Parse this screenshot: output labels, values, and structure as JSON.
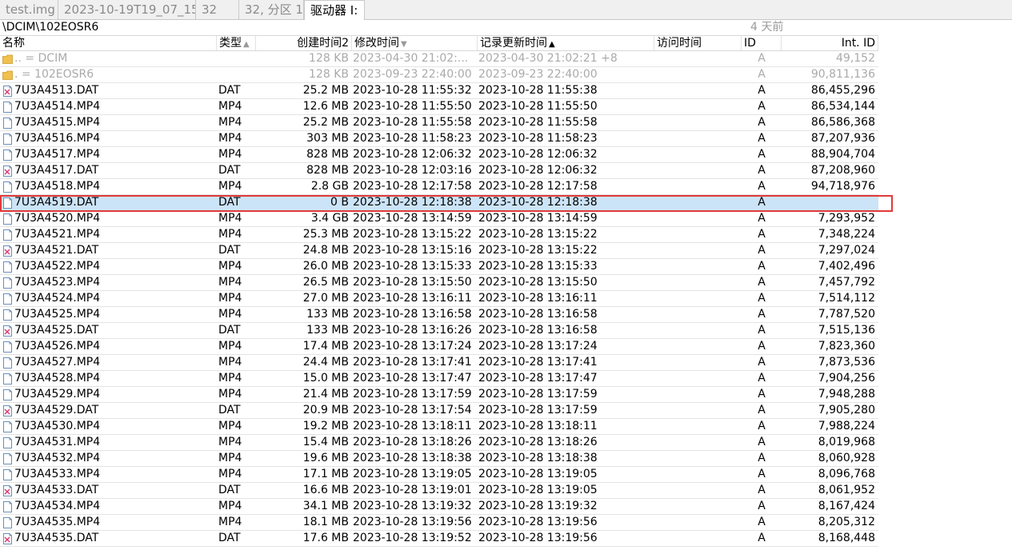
{
  "tabs": [
    "test.img",
    "2023-10-19T19_07_15",
    "32",
    "32, 分区 1",
    "驱动器 I:"
  ],
  "path": "\\DCIM\\102EOSR6",
  "time_ago": "4 天前",
  "columns": {
    "name": "名称",
    "type": "类型",
    "created": "创建时间2",
    "modified": "修改时间",
    "record_updated": "记录更新时间",
    "accessed": "访问时间",
    "id": "ID",
    "int_id": "Int. ID"
  },
  "parent_rows": [
    {
      "name": "..  =   DCIM",
      "size": "128 KB",
      "modified": "2023-04-30  21:02:...",
      "record": "2023-04-30  21:02:21  +8",
      "id": "A",
      "int_id": "49,152"
    },
    {
      "name": ".   =   102EOSR6",
      "size": "128 KB",
      "modified": "2023-09-23  22:40:00",
      "record": "2023-09-23  22:40:00",
      "id": "A",
      "int_id": "90,811,136"
    }
  ],
  "files": [
    {
      "name": "7U3A4513.DAT",
      "type": "DAT",
      "size": "25.2 MB",
      "modified": "2023-10-28  11:55:32",
      "record": "2023-10-28  11:55:38",
      "id": "A",
      "int_id": "86,455,296",
      "icon": "deleted-file-icon"
    },
    {
      "name": "7U3A4514.MP4",
      "type": "MP4",
      "size": "12.6 MB",
      "modified": "2023-10-28  11:55:50",
      "record": "2023-10-28  11:55:50",
      "id": "A",
      "int_id": "86,534,144",
      "icon": "file-icon"
    },
    {
      "name": "7U3A4515.MP4",
      "type": "MP4",
      "size": "25.2 MB",
      "modified": "2023-10-28  11:55:58",
      "record": "2023-10-28  11:55:58",
      "id": "A",
      "int_id": "86,586,368",
      "icon": "file-icon"
    },
    {
      "name": "7U3A4516.MP4",
      "type": "MP4",
      "size": "303 MB",
      "modified": "2023-10-28  11:58:23",
      "record": "2023-10-28  11:58:23",
      "id": "A",
      "int_id": "87,207,936",
      "icon": "file-icon"
    },
    {
      "name": "7U3A4517.MP4",
      "type": "MP4",
      "size": "828 MB",
      "modified": "2023-10-28  12:06:32",
      "record": "2023-10-28  12:06:32",
      "id": "A",
      "int_id": "88,904,704",
      "icon": "file-icon"
    },
    {
      "name": "7U3A4517.DAT",
      "type": "DAT",
      "size": "828 MB",
      "modified": "2023-10-28  12:03:16",
      "record": "2023-10-28  12:06:32",
      "id": "A",
      "int_id": "87,208,960",
      "icon": "deleted-file-icon"
    },
    {
      "name": "7U3A4518.MP4",
      "type": "MP4",
      "size": "2.8 GB",
      "modified": "2023-10-28  12:17:58",
      "record": "2023-10-28  12:17:58",
      "id": "A",
      "int_id": "94,718,976",
      "icon": "file-icon"
    },
    {
      "name": "7U3A4519.DAT",
      "type": "DAT",
      "size": "0 B",
      "modified": "2023-10-28  12:18:38",
      "record": "2023-10-28  12:18:38",
      "id": "A",
      "int_id": "",
      "icon": "file-icon",
      "selected": true
    },
    {
      "name": "7U3A4520.MP4",
      "type": "MP4",
      "size": "3.4 GB",
      "modified": "2023-10-28  13:14:59",
      "record": "2023-10-28  13:14:59",
      "id": "A",
      "int_id": "7,293,952",
      "icon": "file-icon"
    },
    {
      "name": "7U3A4521.MP4",
      "type": "MP4",
      "size": "25.3 MB",
      "modified": "2023-10-28  13:15:22",
      "record": "2023-10-28  13:15:22",
      "id": "A",
      "int_id": "7,348,224",
      "icon": "file-icon"
    },
    {
      "name": "7U3A4521.DAT",
      "type": "DAT",
      "size": "24.8 MB",
      "modified": "2023-10-28  13:15:16",
      "record": "2023-10-28  13:15:22",
      "id": "A",
      "int_id": "7,297,024",
      "icon": "deleted-file-icon"
    },
    {
      "name": "7U3A4522.MP4",
      "type": "MP4",
      "size": "26.0 MB",
      "modified": "2023-10-28  13:15:33",
      "record": "2023-10-28  13:15:33",
      "id": "A",
      "int_id": "7,402,496",
      "icon": "file-icon"
    },
    {
      "name": "7U3A4523.MP4",
      "type": "MP4",
      "size": "26.5 MB",
      "modified": "2023-10-28  13:15:50",
      "record": "2023-10-28  13:15:50",
      "id": "A",
      "int_id": "7,457,792",
      "icon": "file-icon"
    },
    {
      "name": "7U3A4524.MP4",
      "type": "MP4",
      "size": "27.0 MB",
      "modified": "2023-10-28  13:16:11",
      "record": "2023-10-28  13:16:11",
      "id": "A",
      "int_id": "7,514,112",
      "icon": "file-icon"
    },
    {
      "name": "7U3A4525.MP4",
      "type": "MP4",
      "size": "133 MB",
      "modified": "2023-10-28  13:16:58",
      "record": "2023-10-28  13:16:58",
      "id": "A",
      "int_id": "7,787,520",
      "icon": "file-icon"
    },
    {
      "name": "7U3A4525.DAT",
      "type": "DAT",
      "size": "133 MB",
      "modified": "2023-10-28  13:16:26",
      "record": "2023-10-28  13:16:58",
      "id": "A",
      "int_id": "7,515,136",
      "icon": "deleted-file-icon"
    },
    {
      "name": "7U3A4526.MP4",
      "type": "MP4",
      "size": "17.4 MB",
      "modified": "2023-10-28  13:17:24",
      "record": "2023-10-28  13:17:24",
      "id": "A",
      "int_id": "7,823,360",
      "icon": "file-icon"
    },
    {
      "name": "7U3A4527.MP4",
      "type": "MP4",
      "size": "24.4 MB",
      "modified": "2023-10-28  13:17:41",
      "record": "2023-10-28  13:17:41",
      "id": "A",
      "int_id": "7,873,536",
      "icon": "file-icon"
    },
    {
      "name": "7U3A4528.MP4",
      "type": "MP4",
      "size": "15.0 MB",
      "modified": "2023-10-28  13:17:47",
      "record": "2023-10-28  13:17:47",
      "id": "A",
      "int_id": "7,904,256",
      "icon": "file-icon"
    },
    {
      "name": "7U3A4529.MP4",
      "type": "MP4",
      "size": "21.4 MB",
      "modified": "2023-10-28  13:17:59",
      "record": "2023-10-28  13:17:59",
      "id": "A",
      "int_id": "7,948,288",
      "icon": "file-icon"
    },
    {
      "name": "7U3A4529.DAT",
      "type": "DAT",
      "size": "20.9 MB",
      "modified": "2023-10-28  13:17:54",
      "record": "2023-10-28  13:17:59",
      "id": "A",
      "int_id": "7,905,280",
      "icon": "deleted-file-icon"
    },
    {
      "name": "7U3A4530.MP4",
      "type": "MP4",
      "size": "19.2 MB",
      "modified": "2023-10-28  13:18:11",
      "record": "2023-10-28  13:18:11",
      "id": "A",
      "int_id": "7,988,224",
      "icon": "file-icon"
    },
    {
      "name": "7U3A4531.MP4",
      "type": "MP4",
      "size": "15.4 MB",
      "modified": "2023-10-28  13:18:26",
      "record": "2023-10-28  13:18:26",
      "id": "A",
      "int_id": "8,019,968",
      "icon": "file-icon"
    },
    {
      "name": "7U3A4532.MP4",
      "type": "MP4",
      "size": "19.6 MB",
      "modified": "2023-10-28  13:18:38",
      "record": "2023-10-28  13:18:38",
      "id": "A",
      "int_id": "8,060,928",
      "icon": "file-icon"
    },
    {
      "name": "7U3A4533.MP4",
      "type": "MP4",
      "size": "17.1 MB",
      "modified": "2023-10-28  13:19:05",
      "record": "2023-10-28  13:19:05",
      "id": "A",
      "int_id": "8,096,768",
      "icon": "file-icon"
    },
    {
      "name": "7U3A4533.DAT",
      "type": "DAT",
      "size": "16.6 MB",
      "modified": "2023-10-28  13:19:01",
      "record": "2023-10-28  13:19:05",
      "id": "A",
      "int_id": "8,061,952",
      "icon": "deleted-file-icon"
    },
    {
      "name": "7U3A4534.MP4",
      "type": "MP4",
      "size": "34.1 MB",
      "modified": "2023-10-28  13:19:32",
      "record": "2023-10-28  13:19:32",
      "id": "A",
      "int_id": "8,167,424",
      "icon": "file-icon"
    },
    {
      "name": "7U3A4535.MP4",
      "type": "MP4",
      "size": "18.1 MB",
      "modified": "2023-10-28  13:19:56",
      "record": "2023-10-28  13:19:56",
      "id": "A",
      "int_id": "8,205,312",
      "icon": "file-icon"
    },
    {
      "name": "7U3A4535.DAT",
      "type": "DAT",
      "size": "17.6 MB",
      "modified": "2023-10-28  13:19:52",
      "record": "2023-10-28  13:19:56",
      "id": "A",
      "int_id": "8,168,448",
      "icon": "deleted-file-icon"
    }
  ],
  "colors": {
    "selection": "#cce4f7",
    "highlight_border": "#e03a3a",
    "deleted_mark": "#d9346e",
    "folder": "#f2c04e"
  }
}
